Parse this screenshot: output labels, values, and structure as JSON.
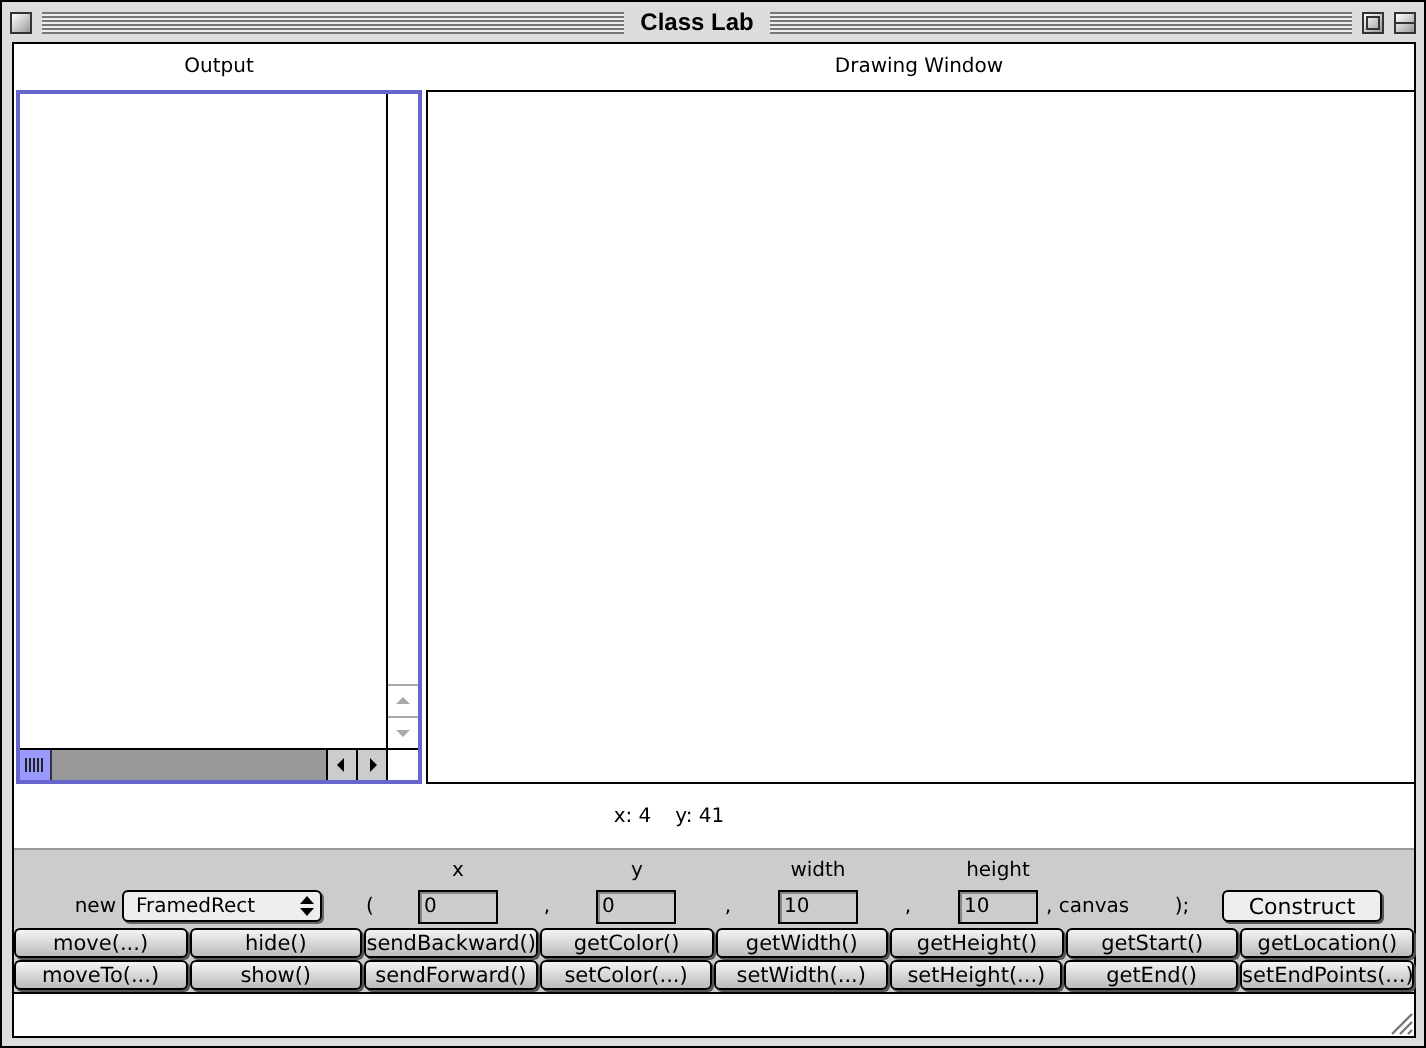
{
  "window": {
    "title": "Class Lab"
  },
  "output": {
    "title": "Output"
  },
  "drawing_window": {
    "title": "Drawing Window"
  },
  "status": {
    "x": "x: 4",
    "y": "y: 41"
  },
  "constructor": {
    "keyword": "new",
    "class_name": "FramedRect",
    "open_paren": "(",
    "fields": [
      {
        "label": "x",
        "value": "0"
      },
      {
        "label": "y",
        "value": "0",
        "separator": ","
      },
      {
        "label": "width",
        "value": "10",
        "separator": ","
      },
      {
        "label": "height",
        "value": "10",
        "separator": ","
      }
    ],
    "canvas": ", canvas",
    "close_paren": ");",
    "button": "Construct"
  },
  "buttons": [
    [
      "move(...)",
      "hide()",
      "sendBackward()",
      "getColor()",
      "getWidth()",
      "getHeight()",
      "getStart()",
      "getLocation()"
    ],
    [
      "moveTo(...)",
      "show()",
      "sendForward()",
      "setColor(...)",
      "setWidth(...)",
      "setHeight(...)",
      "getEnd()",
      "setEndPoints(...)"
    ]
  ]
}
